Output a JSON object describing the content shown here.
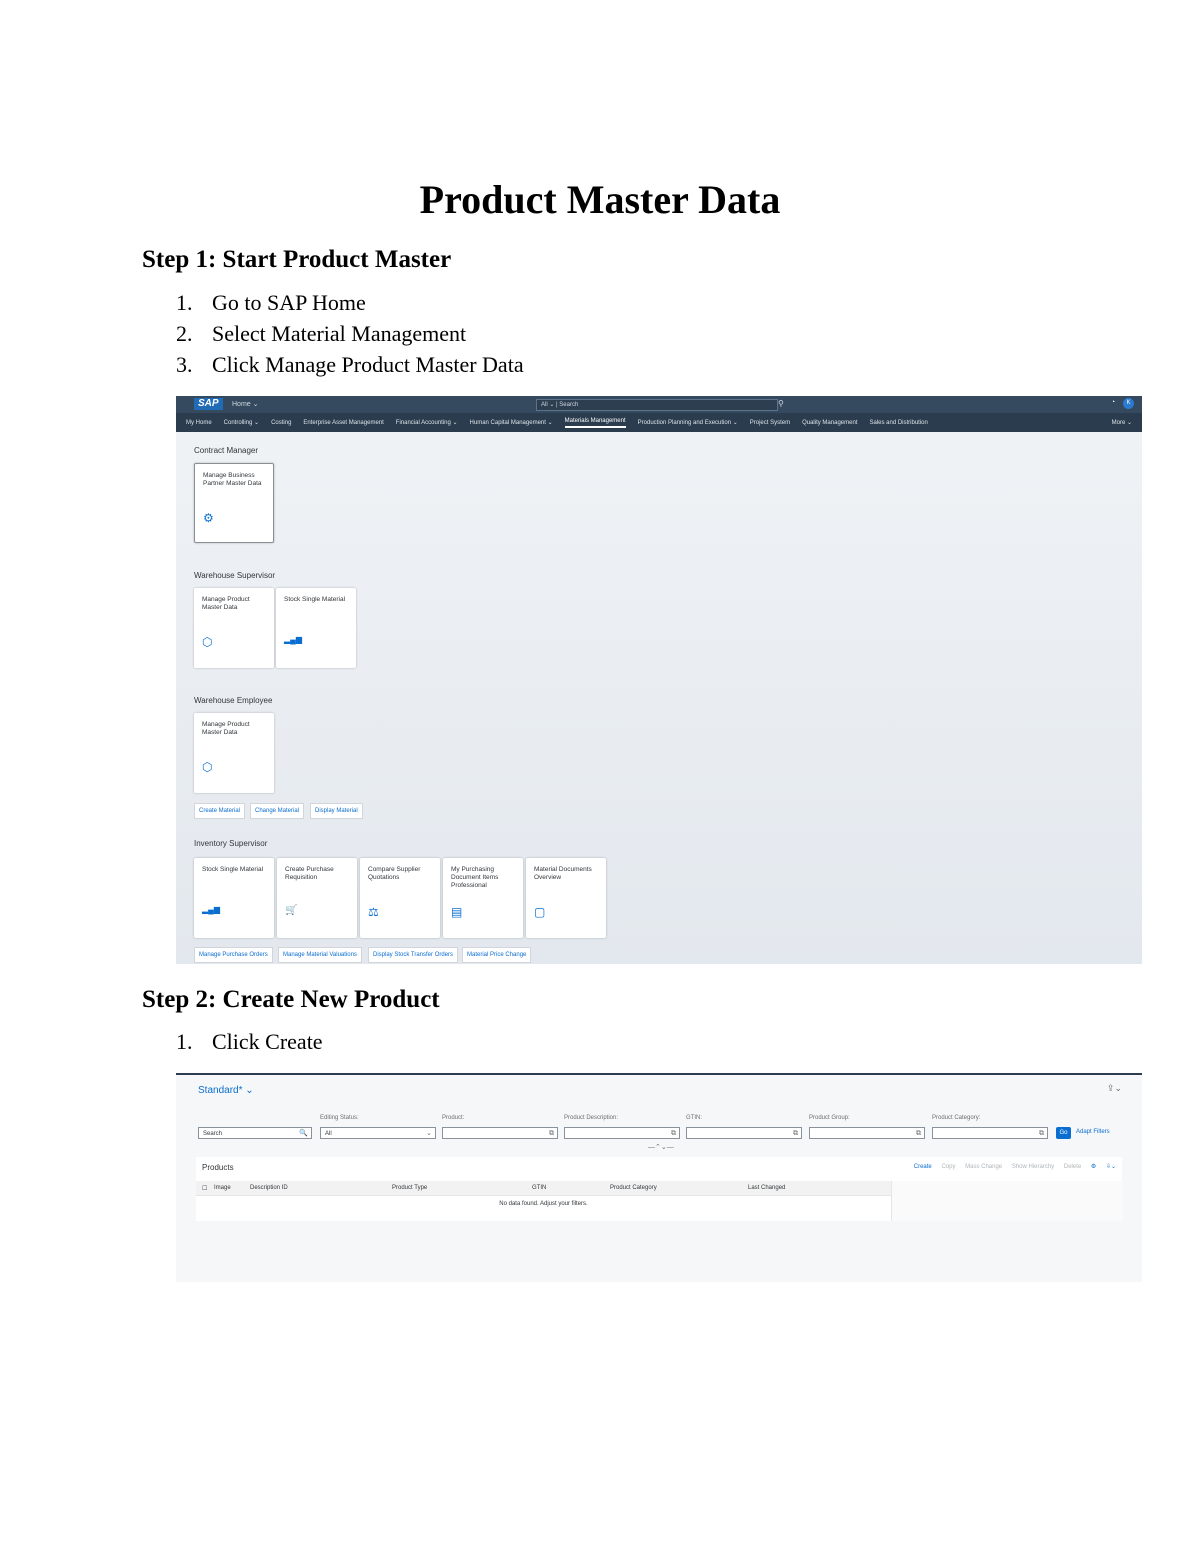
{
  "title": "Product Master Data",
  "step1": {
    "heading": "Step 1: Start Product Master",
    "items": [
      {
        "num": "1.",
        "text": "Go to SAP Home"
      },
      {
        "num": "2.",
        "text": "Select Material Management"
      },
      {
        "num": "3.",
        "text": "Click Manage Product Master Data"
      }
    ]
  },
  "step2": {
    "heading": "Step 2: Create New Product",
    "items": [
      {
        "num": "1.",
        "text": "Click Create"
      }
    ]
  },
  "launchpad": {
    "logo": "SAP",
    "home_menu": "Home ⌄",
    "search_scope": "All ⌄",
    "search_placeholder": "Search",
    "avatar_initial": "K",
    "tabs": [
      "My Home",
      "Controlling ⌄",
      "Costing",
      "Enterprise Asset Management",
      "Financial Accounting ⌄",
      "Human Capital Management ⌄",
      "Materials Management",
      "Production Planning and Execution ⌄",
      "Project System",
      "Quality Management",
      "Sales and Distribution"
    ],
    "active_tab": "Materials Management",
    "more_label": "More ⌄",
    "groups": {
      "contract_manager": {
        "title": "Contract Manager",
        "tiles": [
          {
            "title": "Manage Business Partner Master Data",
            "icon": "⚙"
          }
        ]
      },
      "warehouse_supervisor": {
        "title": "Warehouse Supervisor",
        "tiles": [
          {
            "title": "Manage Product Master Data",
            "icon": "⬡"
          },
          {
            "title": "Stock Single Material",
            "icon": "▂▄▆"
          }
        ]
      },
      "warehouse_employee": {
        "title": "Warehouse Employee",
        "tiles": [
          {
            "title": "Manage Product Master Data",
            "icon": "⬡"
          }
        ],
        "links": [
          "Create Material",
          "Change Material",
          "Display Material"
        ]
      },
      "inventory_supervisor": {
        "title": "Inventory Supervisor",
        "tiles": [
          {
            "title": "Stock Single Material",
            "icon": "▂▄▆"
          },
          {
            "title": "Create Purchase Requisition",
            "icon": "🛒"
          },
          {
            "title": "Compare Supplier Quotations",
            "icon": "⚖"
          },
          {
            "title": "My Purchasing Document Items Professional",
            "icon": "▤"
          },
          {
            "title": "Material Documents Overview",
            "icon": "▢"
          }
        ],
        "links": [
          "Manage Purchase Orders",
          "Manage Material Valuations",
          "Display Stock Transfer Orders",
          "Material Price Change"
        ]
      }
    }
  },
  "product_list": {
    "variant": "Standard* ⌄",
    "filters": [
      {
        "label": "",
        "value": "Search",
        "icon": "🔍"
      },
      {
        "label": "Editing Status:",
        "value": "All",
        "icon": "⌄"
      },
      {
        "label": "Product:",
        "value": "",
        "icon": "⧉"
      },
      {
        "label": "Product Description:",
        "value": "",
        "icon": "⧉"
      },
      {
        "label": "GTIN:",
        "value": "",
        "icon": "⧉"
      },
      {
        "label": "Product Group:",
        "value": "",
        "icon": "⧉"
      },
      {
        "label": "Product Category:",
        "value": "",
        "icon": "⧉"
      }
    ],
    "go_label": "Go",
    "adapt_label": "Adapt Filters",
    "table_title": "Products",
    "actions": [
      "Create",
      "Copy",
      "Mass Change",
      "Show Hierarchy",
      "Delete"
    ],
    "columns": [
      "Image",
      "Description ID",
      "Product Type",
      "GTIN",
      "Product Category",
      "Last Changed"
    ],
    "no_data": "No data found. Adjust your filters."
  }
}
